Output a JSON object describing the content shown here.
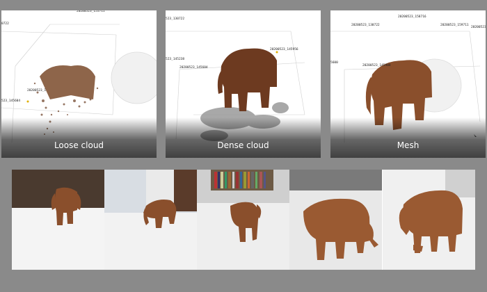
{
  "panels": [
    {
      "caption": "Loose cloud",
      "labels": [
        "20200523_155711",
        "0722",
        "20200523_1",
        "523_145604"
      ]
    },
    {
      "caption": "Dense cloud",
      "labels": [
        "523_130722",
        "20200523_145956",
        "523_145238",
        "20200523_145604"
      ]
    },
    {
      "caption": "Mesh",
      "labels": [
        "20200523_158716",
        "20200523_130722",
        "20200523_159711",
        "20200523_1",
        "5600",
        "20200523_145904"
      ]
    }
  ],
  "photos": [
    {
      "label": "photo-front"
    },
    {
      "label": "photo-left"
    },
    {
      "label": "photo-back"
    },
    {
      "label": "photo-side"
    },
    {
      "label": "photo-close"
    }
  ]
}
